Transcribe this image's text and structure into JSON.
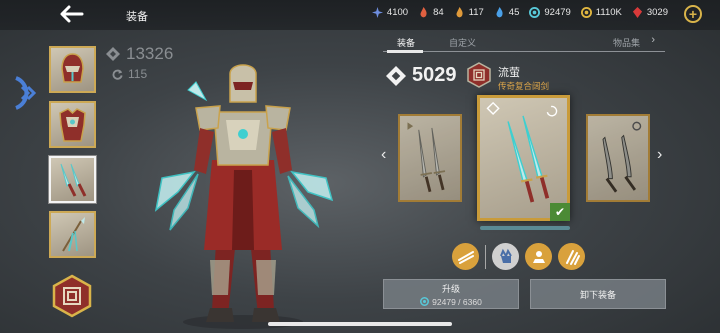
{
  "header": {
    "title": "装备",
    "currencies": [
      {
        "icon": "star-crystal-icon",
        "value": "4100",
        "color": "#6f8fe0"
      },
      {
        "icon": "red-flame-icon",
        "value": "84",
        "color": "#e06040"
      },
      {
        "icon": "orange-flame-icon",
        "value": "117",
        "color": "#e09a3a"
      },
      {
        "icon": "blue-flame-icon",
        "value": "45",
        "color": "#4aa0e8"
      },
      {
        "icon": "soul-shard-icon",
        "value": "92479",
        "color": "#58c8d8"
      },
      {
        "icon": "gold-coin-icon",
        "value": "1110K",
        "color": "#e0b640"
      },
      {
        "icon": "ruby-gem-icon",
        "value": "3029",
        "color": "#d83a3a"
      }
    ]
  },
  "hero": {
    "power": "13326",
    "level": "115"
  },
  "tabs": [
    {
      "label": "装备",
      "active": true
    },
    {
      "label": "自定义",
      "active": false
    },
    {
      "label": "物品集",
      "active": false
    }
  ],
  "item": {
    "power": "5029",
    "name": "流萤",
    "type": "传奇复合阔剑"
  },
  "actions": {
    "upgrade_label": "升级",
    "upgrade_cost": "92479 / 6360",
    "unequip_label": "卸下装备"
  },
  "colors": {
    "accent_gold": "#d9b44a",
    "legendary_orange": "#e0a84a",
    "equipped_green": "#4b8a35"
  }
}
